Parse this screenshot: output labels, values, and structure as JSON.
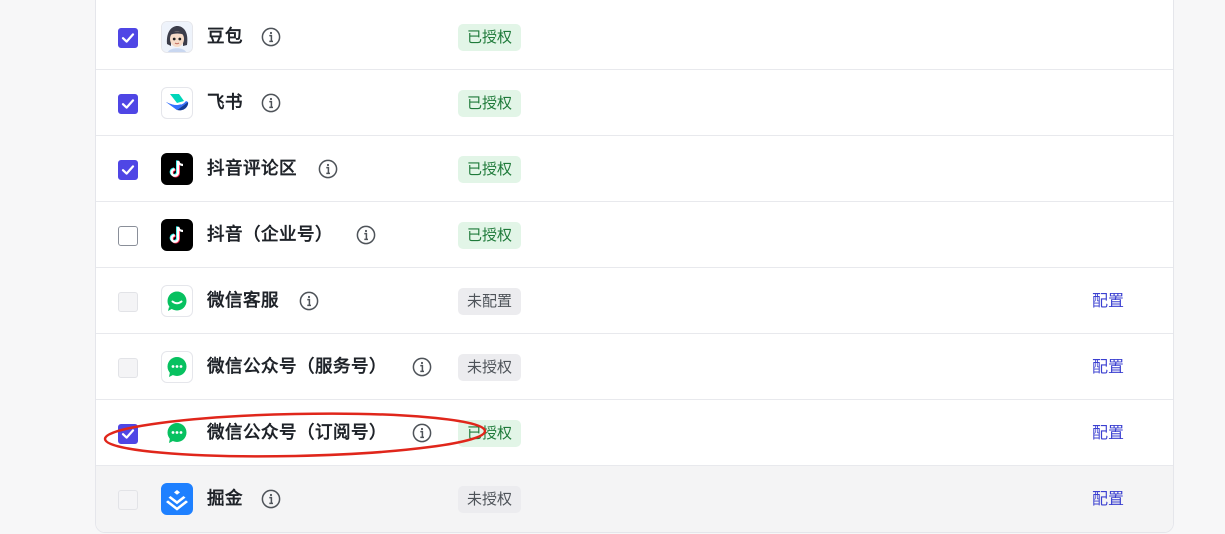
{
  "rows": [
    {
      "name": "豆包",
      "status": "已授权",
      "checked": true,
      "icon": "doubao-avatar-icon"
    },
    {
      "name": "飞书",
      "status": "已授权",
      "checked": true,
      "icon": "feishu-icon"
    },
    {
      "name": "抖音评论区",
      "status": "已授权",
      "checked": true,
      "icon": "douyin-icon"
    },
    {
      "name": "抖音（企业号）",
      "status": "已授权",
      "checked": false,
      "icon": "douyin-icon"
    },
    {
      "name": "微信客服",
      "status": "未配置",
      "checked": false,
      "disabled": true,
      "action": "配置",
      "icon": "wechat-service-icon"
    },
    {
      "name": "微信公众号（服务号）",
      "status": "未授权",
      "checked": false,
      "disabled": true,
      "action": "配置",
      "icon": "wechat-icon"
    },
    {
      "name": "微信公众号（订阅号）",
      "status": "已授权",
      "checked": true,
      "action": "配置",
      "icon": "wechat-icon"
    },
    {
      "name": "掘金",
      "status": "未授权",
      "checked": false,
      "disabled": true,
      "action": "配置",
      "icon": "juejin-icon"
    }
  ],
  "colors": {
    "accent": "#4f46e5",
    "link": "#3a3fd0",
    "authorized_bg": "#e2f5e7",
    "authorized_text": "#1f7a3a",
    "unauthorized_bg": "#ececef",
    "annotation": "#e0261b"
  }
}
